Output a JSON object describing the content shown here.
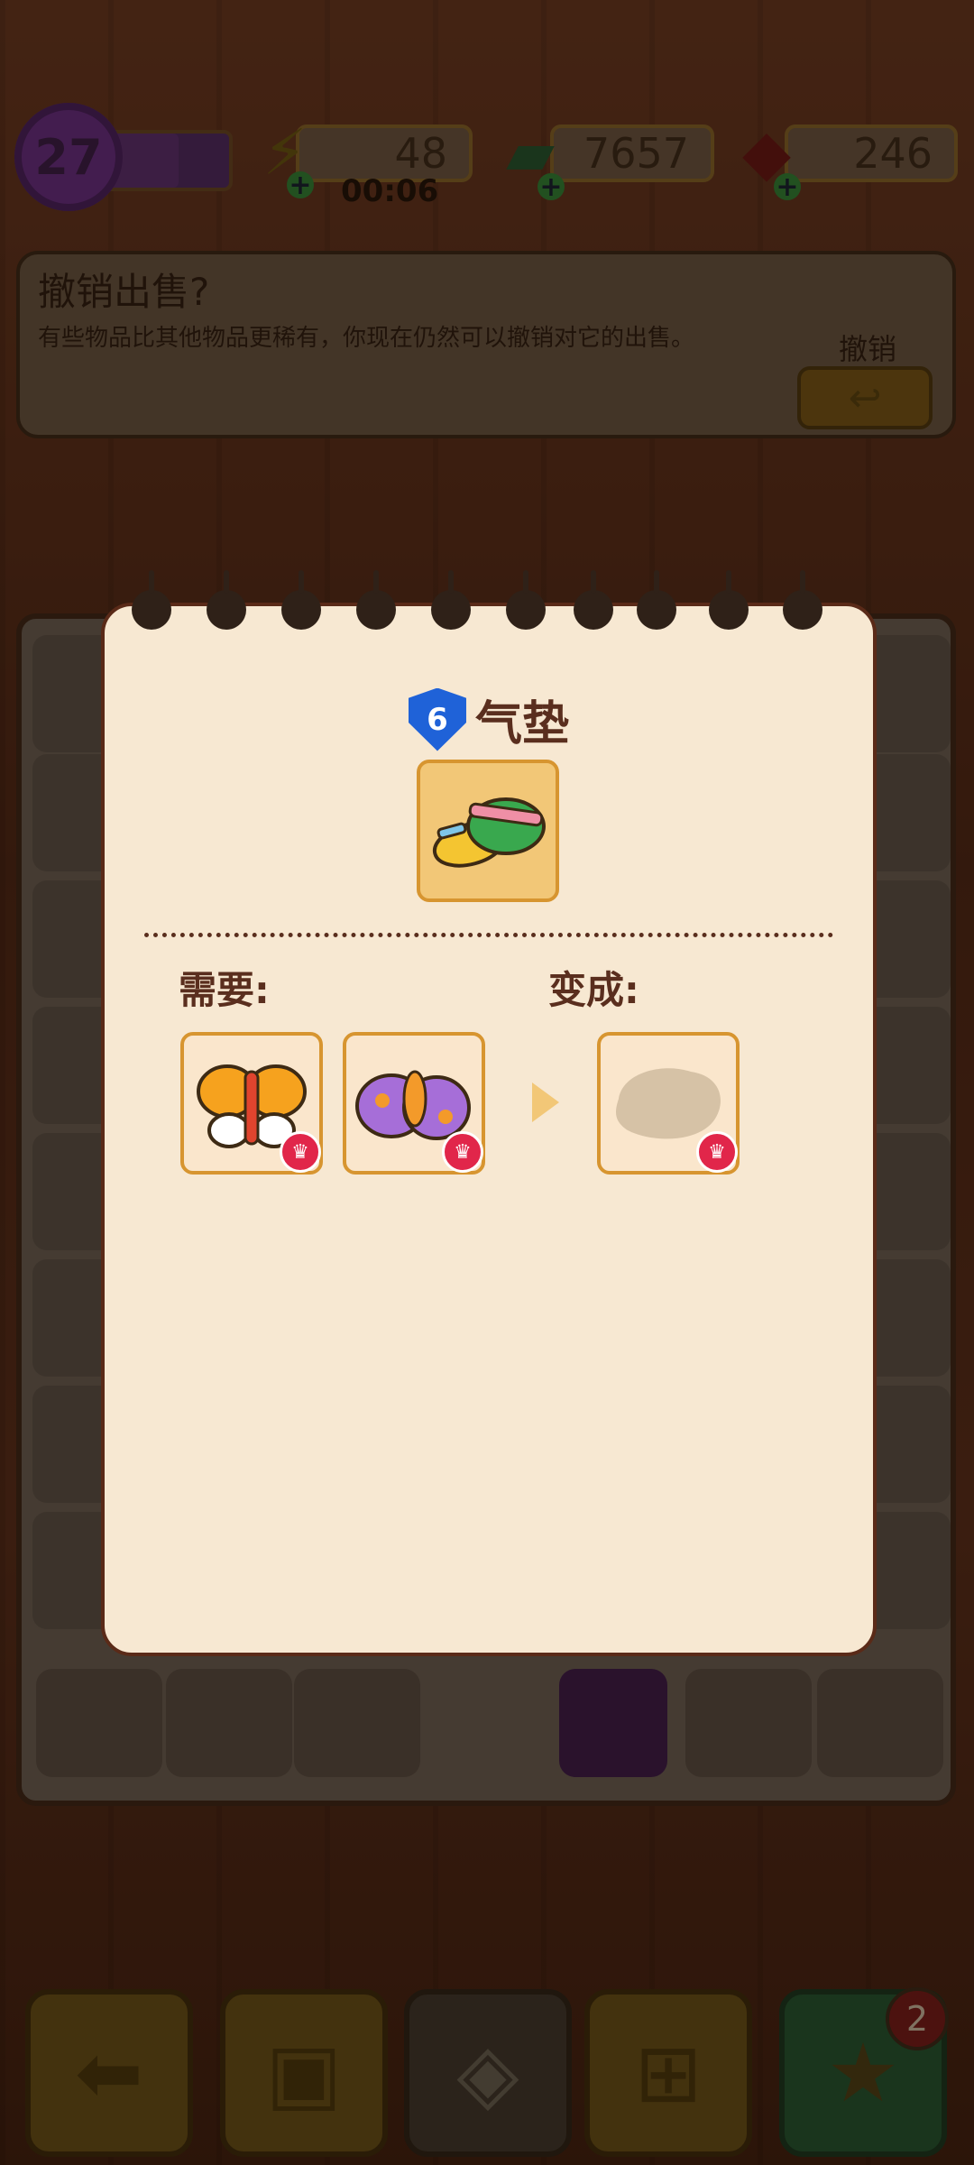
{
  "top_bar": {
    "level": "27",
    "level_progress": 0.6,
    "energy": "48",
    "energy_timer": "00:06",
    "cash": "7657",
    "gems": "246"
  },
  "undo_sale": {
    "title": "撤销出售?",
    "description": "有些物品比其他物品更稀有，你现在仍然可以撤销对它的出售。",
    "button_label": "撤销"
  },
  "item_card": {
    "level": "6",
    "name": "气垫",
    "requires_label": "需要:",
    "becomes_label": "变成:",
    "required_items": [
      "butterfly-item",
      "moth-item"
    ],
    "result_item": "unknown-item"
  },
  "bottom_bar": {
    "favorites_count": "2"
  },
  "colors": {
    "card_bg": "#f7e8d2",
    "tile_bg": "#f2c777",
    "shield_blue": "#1f62d8",
    "crown_red": "#e1264a"
  }
}
